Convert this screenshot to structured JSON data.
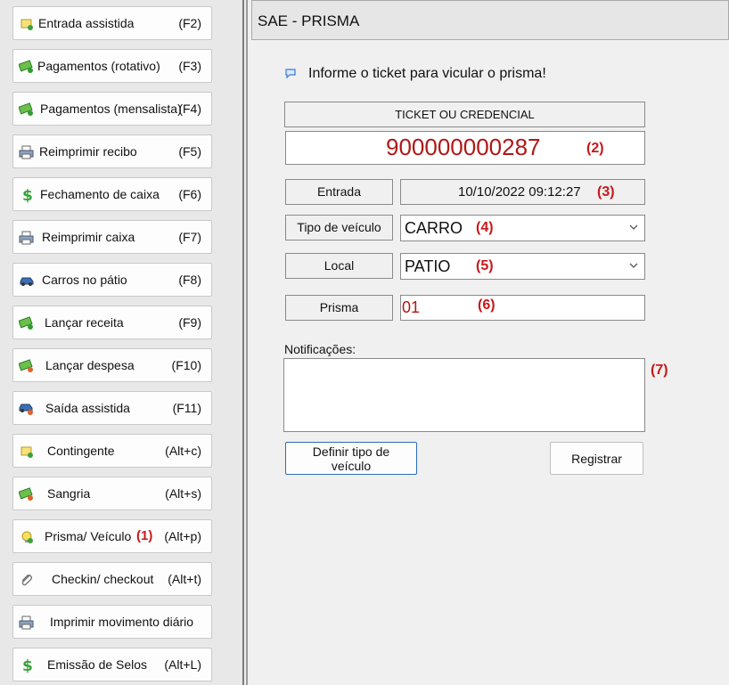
{
  "sidebar": {
    "items": [
      {
        "label": "Entrada assistida",
        "shortcut": "(F2)",
        "icon": "entry-note-icon"
      },
      {
        "label": "Pagamentos (rotativo)",
        "shortcut": "(F3)",
        "icon": "money-add-icon"
      },
      {
        "label": "Pagamentos (mensalista)",
        "shortcut": "(F4)",
        "icon": "money-add-icon"
      },
      {
        "label": "Reimprimir recibo",
        "shortcut": "(F5)",
        "icon": "printer-icon"
      },
      {
        "label": "Fechamento de caixa",
        "shortcut": "(F6)",
        "icon": "dollar-icon"
      },
      {
        "label": "Reimprimir caixa",
        "shortcut": "(F7)",
        "icon": "printer-icon"
      },
      {
        "label": "Carros no pátio",
        "shortcut": "(F8)",
        "icon": "car-icon"
      },
      {
        "label": "Lançar receita",
        "shortcut": "(F9)",
        "icon": "money-add-icon"
      },
      {
        "label": "Lançar despesa",
        "shortcut": "(F10)",
        "icon": "money-remove-icon"
      },
      {
        "label": "Saída assistida",
        "shortcut": "(F11)",
        "icon": "car-exit-icon"
      },
      {
        "label": "Contingente",
        "shortcut": "(Alt+c)",
        "icon": "entry-note-icon"
      },
      {
        "label": "Sangria",
        "shortcut": "(Alt+s)",
        "icon": "money-remove-icon"
      },
      {
        "label": "Prisma/ Veículo",
        "annotation": "(1)",
        "shortcut": "(Alt+p)",
        "icon": "lightbulb-icon"
      },
      {
        "label": "Checkin/ checkout",
        "shortcut": "(Alt+t)",
        "icon": "paperclip-icon"
      },
      {
        "label": "Imprimir movimento diário",
        "shortcut": "",
        "icon": "printer-icon"
      },
      {
        "label": "Emissão de Selos",
        "shortcut": "(Alt+L)",
        "icon": "dollar-icon"
      }
    ]
  },
  "window": {
    "title": "SAE - PRISMA"
  },
  "form": {
    "info_message": "Informe o ticket para vicular o prisma!",
    "ticket_header": "TICKET OU CREDENCIAL",
    "ticket_value": "900000000287",
    "ticket_ref": "(2)",
    "entrada_label": "Entrada",
    "entrada_value": "10/10/2022 09:12:27",
    "entrada_ref": "(3)",
    "tipo_label": "Tipo de veículo",
    "tipo_value": "CARRO",
    "tipo_ref": "(4)",
    "local_label": "Local",
    "local_value": "PATIO",
    "local_ref": "(5)",
    "prisma_label": "Prisma",
    "prisma_value": "01",
    "prisma_ref": "(6)",
    "notificacoes_label": "Notificações:",
    "notificacoes_value": "",
    "notificacoes_ref": "(7)",
    "define_button": "Definir tipo de veículo",
    "register_button": "Registrar"
  },
  "colors": {
    "accent_red": "#c8181a",
    "ticket_red": "#b01818",
    "focus_blue": "#2a6cb8"
  }
}
